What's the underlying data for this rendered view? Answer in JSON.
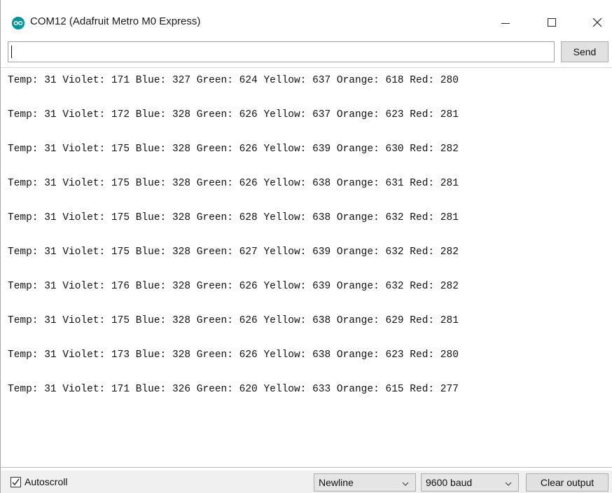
{
  "window": {
    "title": "COM12 (Adafruit Metro M0 Express)",
    "icon": "arduino-icon",
    "accent_color": "#00979c"
  },
  "send_bar": {
    "input_value": "",
    "send_label": "Send"
  },
  "output": {
    "lines": [
      "Temp: 31 Violet: 171 Blue: 327 Green: 624 Yellow: 637 Orange: 618 Red: 280",
      "Temp: 31 Violet: 172 Blue: 328 Green: 626 Yellow: 637 Orange: 623 Red: 281",
      "Temp: 31 Violet: 175 Blue: 328 Green: 626 Yellow: 639 Orange: 630 Red: 282",
      "Temp: 31 Violet: 175 Blue: 328 Green: 626 Yellow: 638 Orange: 631 Red: 281",
      "Temp: 31 Violet: 175 Blue: 328 Green: 628 Yellow: 638 Orange: 632 Red: 281",
      "Temp: 31 Violet: 175 Blue: 328 Green: 627 Yellow: 639 Orange: 632 Red: 282",
      "Temp: 31 Violet: 176 Blue: 328 Green: 626 Yellow: 639 Orange: 632 Red: 282",
      "Temp: 31 Violet: 175 Blue: 328 Green: 626 Yellow: 638 Orange: 629 Red: 281",
      "Temp: 31 Violet: 173 Blue: 328 Green: 626 Yellow: 638 Orange: 623 Red: 280",
      "Temp: 31 Violet: 171 Blue: 326 Green: 620 Yellow: 633 Orange: 615 Red: 277"
    ]
  },
  "status_bar": {
    "autoscroll_label": "Autoscroll",
    "autoscroll_checked": true,
    "line_ending": "Newline",
    "baud_rate": "9600 baud",
    "clear_label": "Clear output"
  }
}
